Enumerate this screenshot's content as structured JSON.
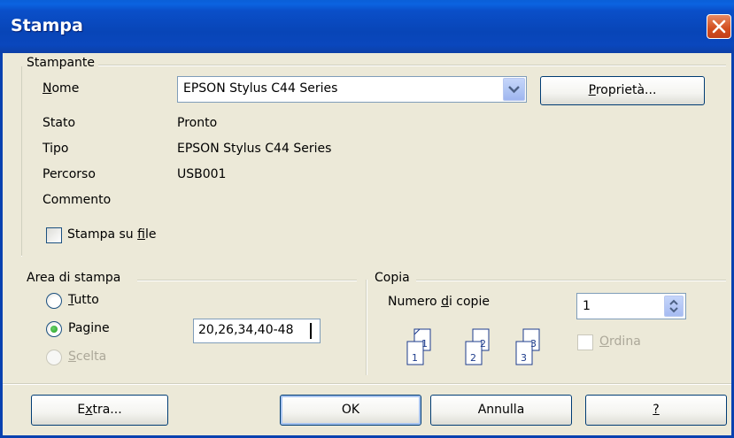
{
  "window": {
    "title": "Stampa"
  },
  "printer": {
    "group_label": "Stampante",
    "name_label": "Nome",
    "name_value": "EPSON Stylus C44 Series",
    "properties_button": "Proprietà...",
    "status_label": "Stato",
    "status_value": "Pronto",
    "type_label": "Tipo",
    "type_value": "EPSON Stylus C44 Series",
    "path_label": "Percorso",
    "path_value": "USB001",
    "comment_label": "Commento",
    "comment_value": "",
    "print_to_file_label": "Stampa su file",
    "print_to_file_checked": false
  },
  "print_range": {
    "group_label": "Area di stampa",
    "all_label": "Tutto",
    "pages_label": "Pagine",
    "selection_label": "Scelta",
    "selected": "pages",
    "pages_value": "20,26,34,40-48"
  },
  "copies": {
    "group_label": "Copia",
    "count_label": "Numero di copie",
    "count_value": "1",
    "collate_label": "Ordina",
    "collate_checked": false,
    "collate_icon_pages": [
      "1",
      "2",
      "3"
    ]
  },
  "buttons": {
    "extra": "Extra...",
    "ok": "OK",
    "cancel": "Annulla",
    "help": "?"
  },
  "colors": {
    "titlebar": "#0a4fc9",
    "dialog_bg": "#ece9d8",
    "close": "#d24d1e"
  }
}
